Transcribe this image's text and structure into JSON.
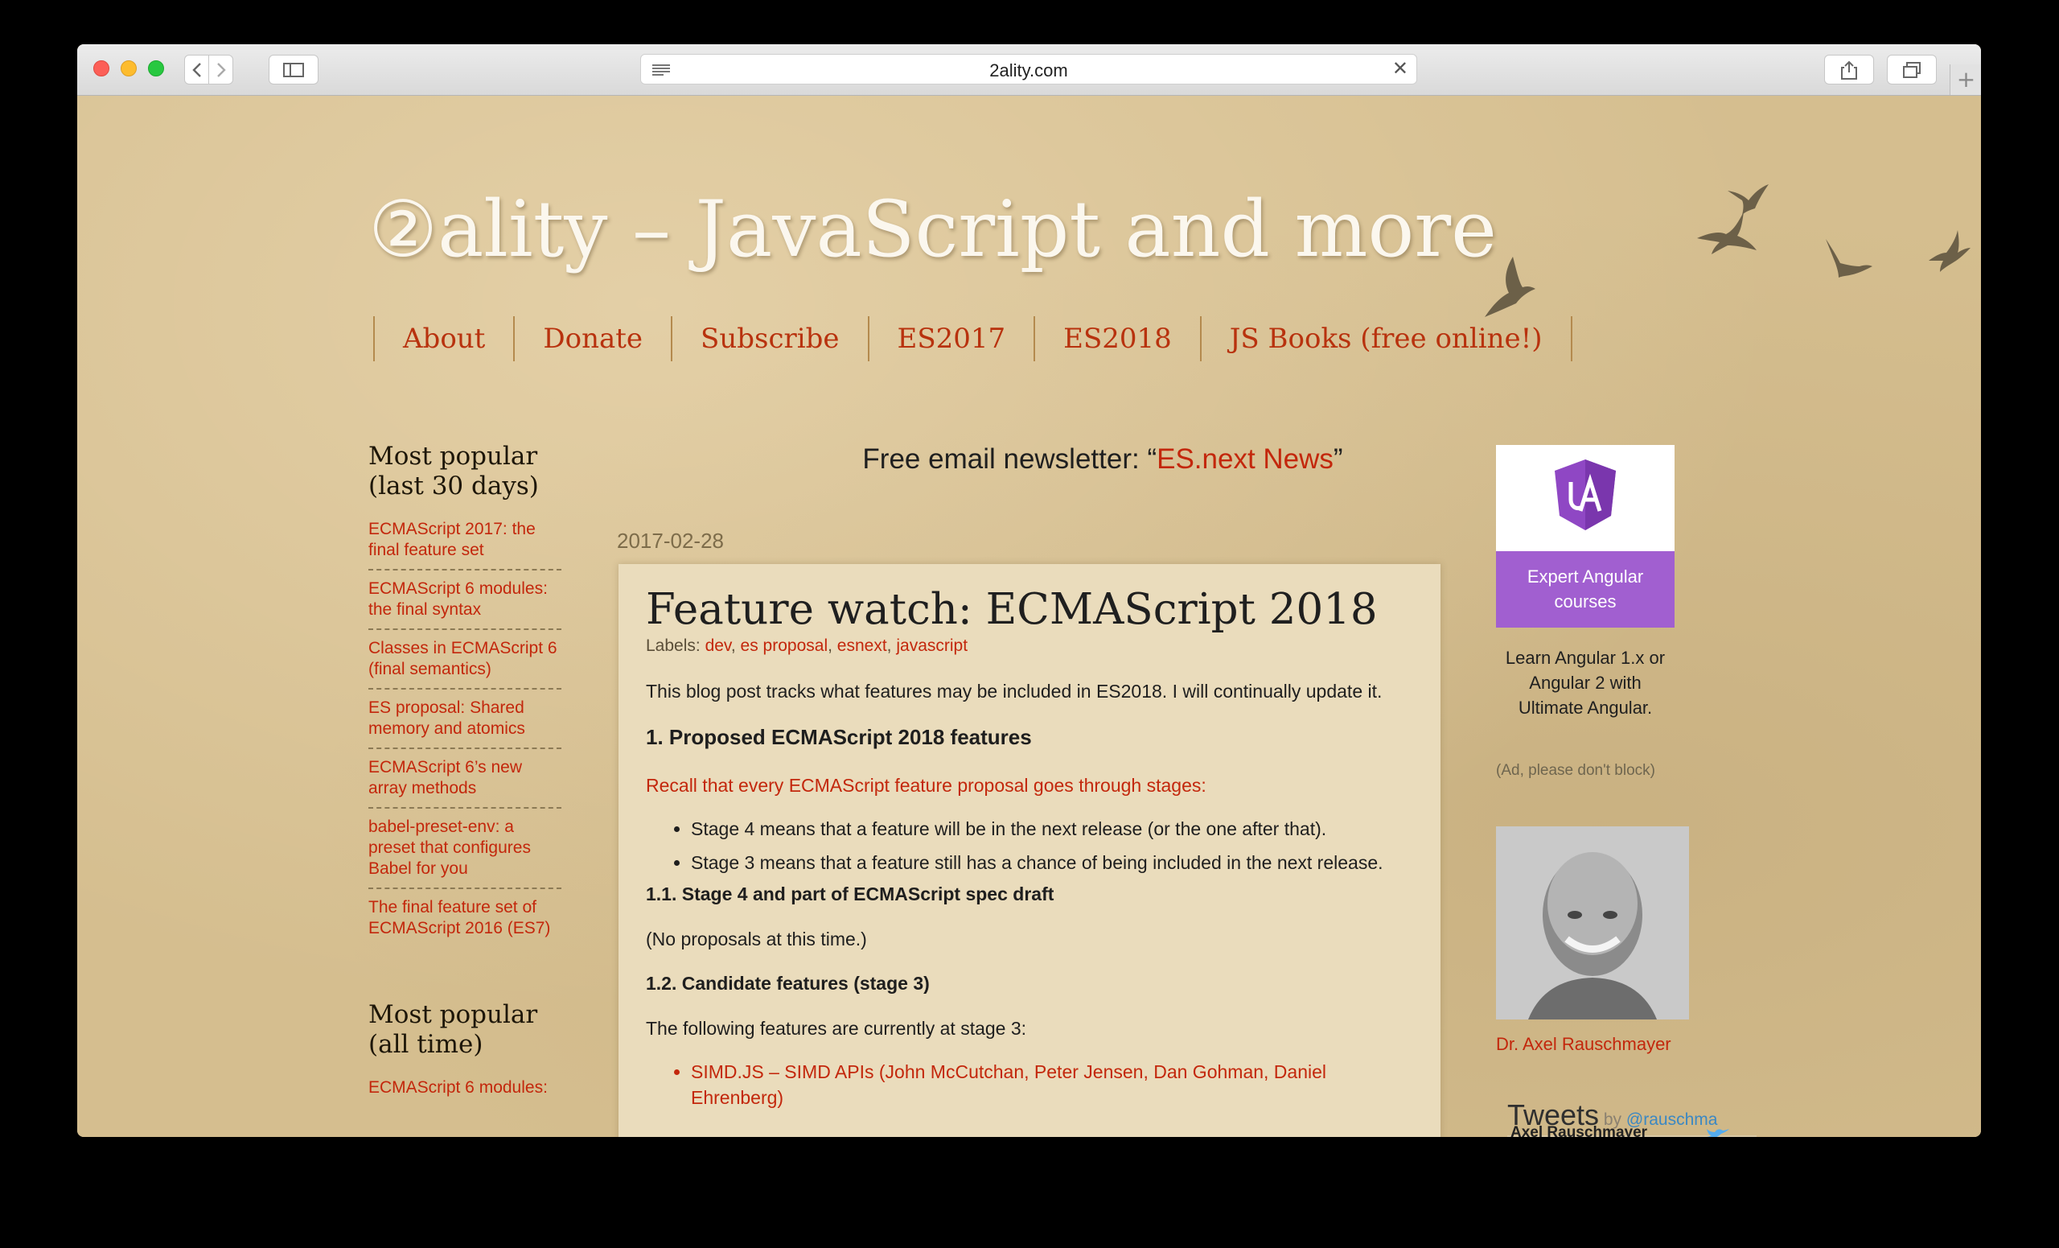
{
  "browser": {
    "url": "2ality.com"
  },
  "site": {
    "title": "②ality – JavaScript and more",
    "nav": [
      "About",
      "Donate",
      "Subscribe",
      "ES2017",
      "ES2018",
      "JS Books (free online!)"
    ]
  },
  "sidebar_left": {
    "popular_30_title_line1": "Most popular",
    "popular_30_title_line2": "(last 30 days)",
    "popular_30": [
      "ECMAScript 2017: the final feature set",
      "ECMAScript 6 modules: the final syntax",
      "Classes in ECMAScript 6 (final semantics)",
      "ES proposal: Shared memory and atomics",
      "ECMAScript 6’s new array methods",
      "babel-preset-env: a preset that configures Babel for you",
      "The final feature set of ECMAScript 2016 (ES7)"
    ],
    "popular_all_title_line1": "Most popular",
    "popular_all_title_line2": "(all time)",
    "popular_all": [
      "ECMAScript 6 modules:"
    ]
  },
  "newsletter": {
    "prefix": "Free email newsletter: “",
    "link": "ES.next News",
    "suffix": "”"
  },
  "post": {
    "date": "2017-02-28",
    "title": "Feature watch: ECMAScript 2018",
    "labels_prefix": "Labels: ",
    "labels": [
      "dev",
      "es proposal",
      "esnext",
      "javascript"
    ],
    "intro": "This blog post tracks what features may be included in ES2018. I will continually update it.",
    "h2": "1.  Proposed ECMAScript 2018 features",
    "recall": "Recall that every ECMAScript feature proposal goes through stages",
    "recall_colon": ":",
    "stages": [
      "Stage 4 means that a feature will be in the next release (or the one after that).",
      "Stage 3 means that a feature still has a chance of being included in the next release."
    ],
    "h3_1": "1.1.  Stage 4 and part of ECMAScript spec draft",
    "none": "(No proposals at this time.)",
    "h3_2": "1.2.  Candidate features (stage 3)",
    "following": "The following features are currently at stage 3:",
    "stage3": [
      "SIMD.JS – SIMD APIs (John McCutchan, Peter Jensen, Dan Gohman, Daniel Ehrenberg)"
    ]
  },
  "sidebar_right": {
    "ad_title": "Expert Angular courses",
    "ad_text": "Learn Angular 1.x or Angular 2 with Ultimate Angular.",
    "ad_note": "(Ad, please don't block)",
    "author": "Dr. Axel Rauschmayer",
    "tweets_title": "Tweets",
    "tweets_by": " by ",
    "tweets_handle": "@rauschma",
    "tweet_author": "Axel Rauschmayer"
  },
  "colors": {
    "link": "#c3270c",
    "background": "#d5be8f",
    "post_bg": "#eadcbc",
    "ad_purple": "#a15fd0"
  }
}
